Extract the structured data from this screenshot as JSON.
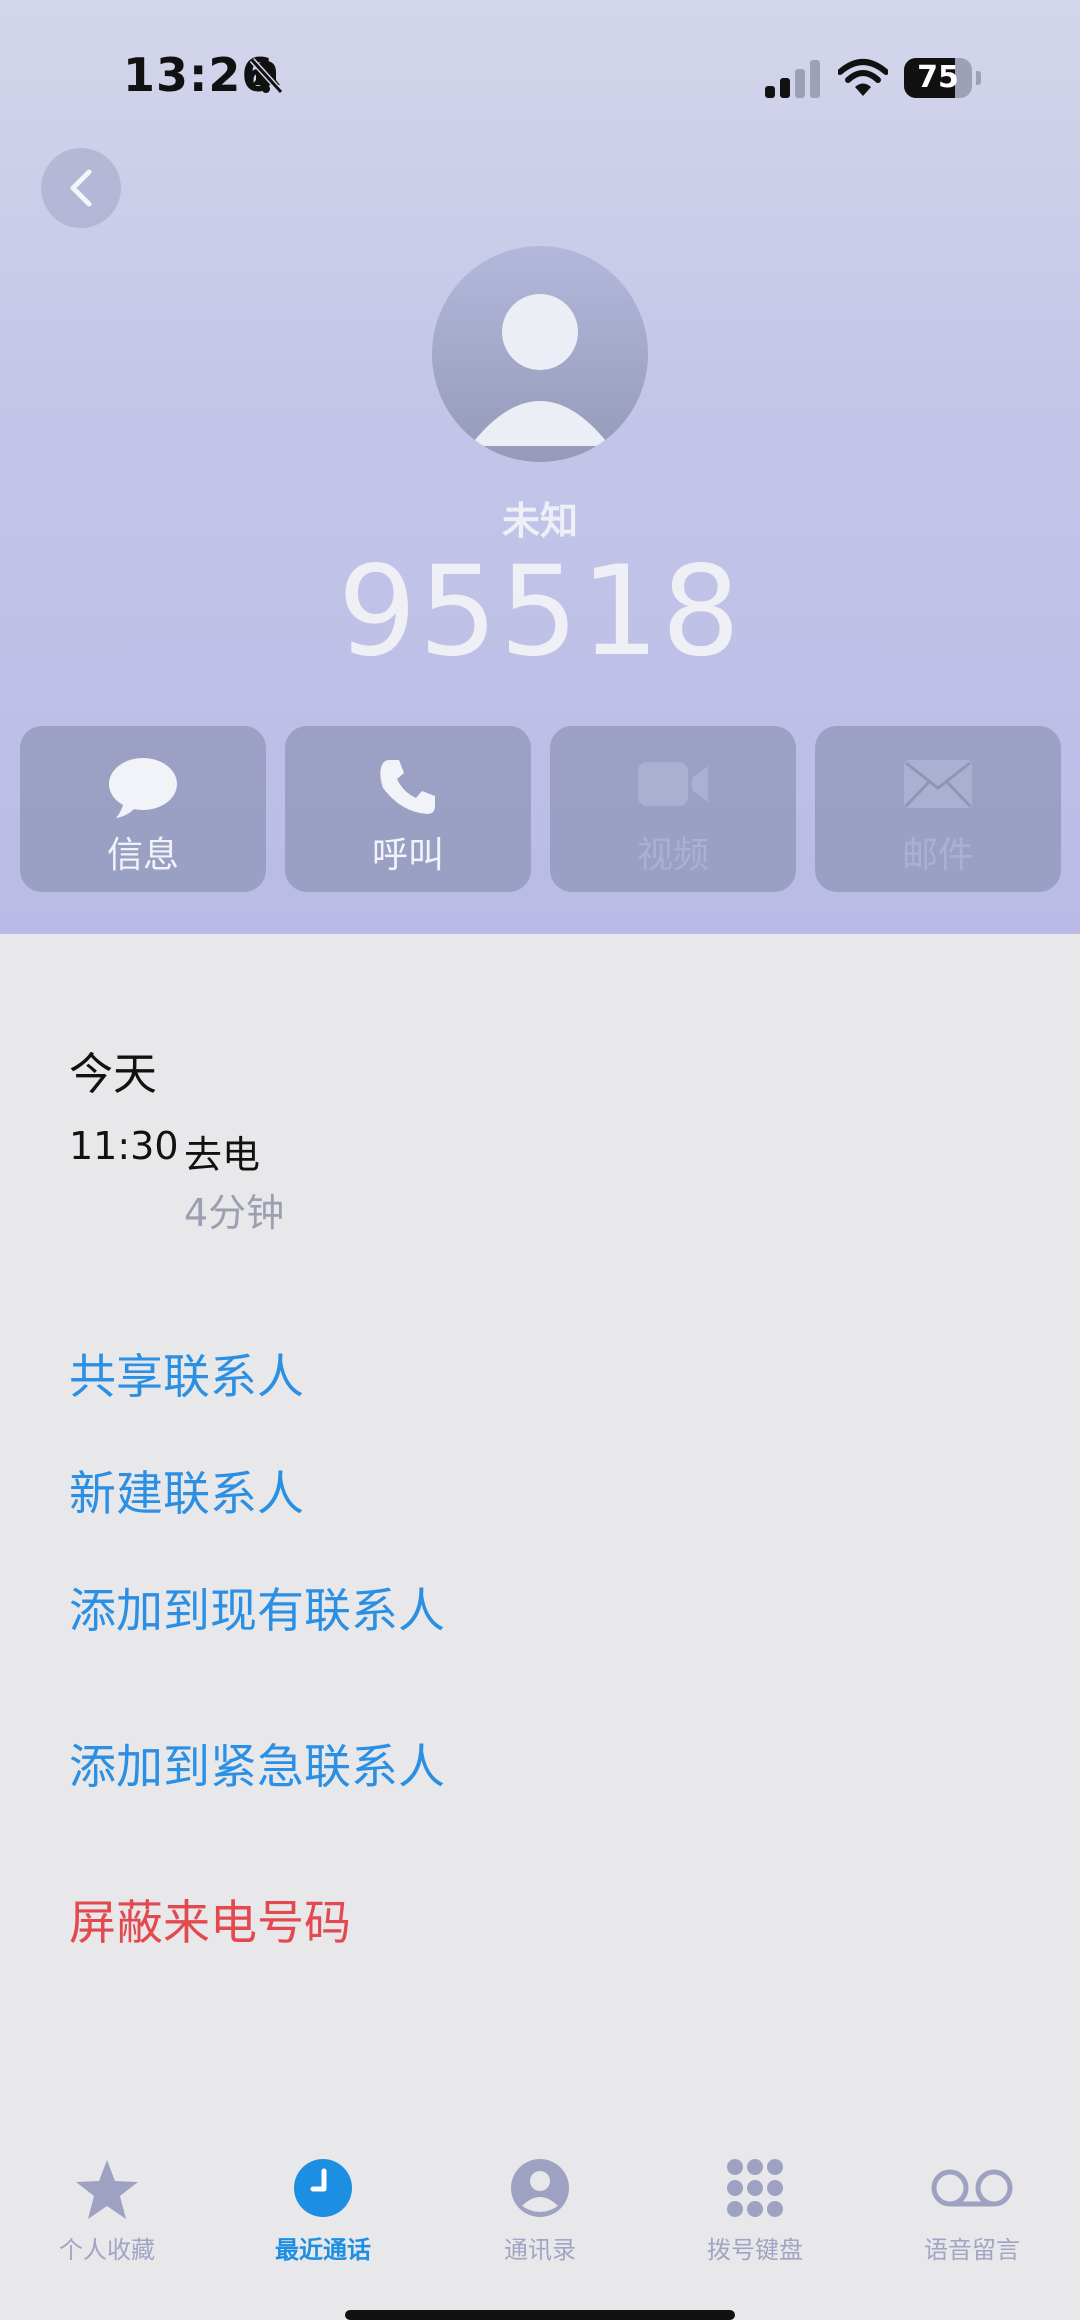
{
  "status_bar": {
    "time": "13:26",
    "battery": "75",
    "battery_level": 0.75
  },
  "contact": {
    "name": "未知",
    "number": "95518"
  },
  "actions": [
    {
      "id": "message",
      "label": "信息",
      "enabled": true
    },
    {
      "id": "call",
      "label": "呼叫",
      "enabled": true
    },
    {
      "id": "video",
      "label": "视频",
      "enabled": false
    },
    {
      "id": "mail",
      "label": "邮件",
      "enabled": false
    }
  ],
  "call_history": {
    "section": "今天",
    "entries": [
      {
        "time": "11:30",
        "type": "去电",
        "duration": "4分钟"
      }
    ]
  },
  "options": {
    "share_contact": "共享联系人",
    "new_contact": "新建联系人",
    "add_existing": "添加到现有联系人",
    "add_emergency": "添加到紧急联系人",
    "block_caller": "屏蔽来电号码"
  },
  "tabs": [
    {
      "label": "个人收藏",
      "icon": "star-icon",
      "active": false
    },
    {
      "label": "最近通话",
      "icon": "clock-icon",
      "active": true
    },
    {
      "label": "通讯录",
      "icon": "person-circle-icon",
      "active": false
    },
    {
      "label": "拨号键盘",
      "icon": "keypad-icon",
      "active": false
    },
    {
      "label": "语音留言",
      "icon": "voicemail-icon",
      "active": false
    }
  ],
  "colors": {
    "accent": "#2b8fe4",
    "destructive": "#e34a4f",
    "tab_active": "#1d8fe3",
    "tab_inactive": "#a2a4c4"
  }
}
